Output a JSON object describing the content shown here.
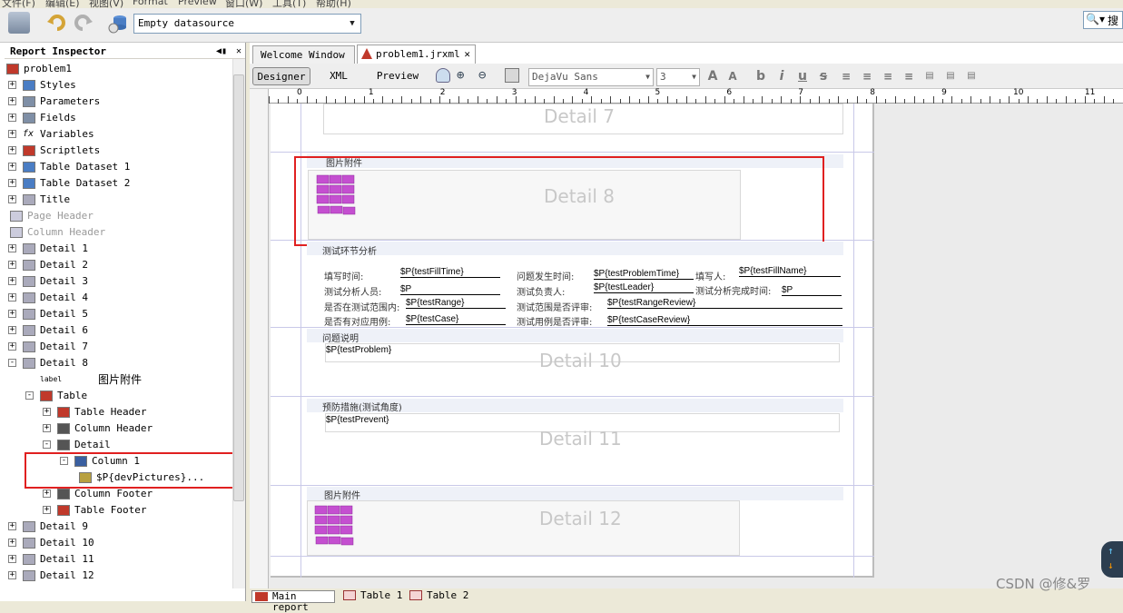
{
  "menubar": {
    "items": [
      "文件(F)",
      "编辑(E)",
      "视图(V)",
      "Format",
      "Preview",
      "窗口(W)",
      "工具(T)",
      "帮助(H)"
    ]
  },
  "toolbar": {
    "datasource": "Empty datasource",
    "search_label": "搜"
  },
  "inspector": {
    "title": "Report Inspector",
    "items": [
      {
        "label": "problem1",
        "indent": 0
      },
      {
        "label": "Styles"
      },
      {
        "label": "Parameters"
      },
      {
        "label": "Fields"
      },
      {
        "label": "Variables"
      },
      {
        "label": "Scriptlets"
      },
      {
        "label": "Table Dataset 1"
      },
      {
        "label": "Table Dataset 2"
      },
      {
        "label": "Title"
      },
      {
        "label": "Page Header"
      },
      {
        "label": "Column Header"
      },
      {
        "label": "Detail 1"
      },
      {
        "label": "Detail 2"
      },
      {
        "label": "Detail 3"
      },
      {
        "label": "Detail 4"
      },
      {
        "label": "Detail 5"
      },
      {
        "label": "Detail 6"
      },
      {
        "label": "Detail 7"
      },
      {
        "label": "Detail 8"
      },
      {
        "label": "label"
      },
      {
        "label": "Table"
      },
      {
        "label": "Table Header"
      },
      {
        "label": "Column Header"
      },
      {
        "label": "Detail"
      },
      {
        "label": "Column 1"
      },
      {
        "label": "$P{devPictures}..."
      },
      {
        "label": "Column Footer"
      },
      {
        "label": "Table Footer"
      },
      {
        "label": "Detail 9"
      },
      {
        "label": "Detail 10"
      },
      {
        "label": "Detail 11"
      },
      {
        "label": "Detail 12"
      }
    ],
    "annotation": "图片附件"
  },
  "editor": {
    "tabs": [
      "Welcome Window",
      "problem1.jrxml"
    ],
    "view_buttons": [
      "Designer",
      "XML",
      "Preview"
    ],
    "font_name": "DejaVu Sans",
    "font_size": "3",
    "ruler_labels": [
      "0",
      "1",
      "2",
      "3",
      "4",
      "5",
      "6",
      "7",
      "8",
      "9",
      "10",
      "11"
    ]
  },
  "design": {
    "bands": {
      "detail7": "Detail 7",
      "detail8": "Detail 8",
      "detail10": "Detail 10",
      "detail11": "Detail 11",
      "detail12": "Detail 12"
    },
    "attach_label_1": "图片附件",
    "attach_label_2": "图片附件",
    "analysis_title": "测试环节分析",
    "fill_time_label": "填写时间:",
    "fill_time_field": "$P{testFillTime}",
    "problem_time_label": "问题发生时间:",
    "problem_time_field": "$P{testProblemTime}",
    "filler_label": "填写人:",
    "filler_field": "$P{testFillName}",
    "analyst_label": "测试分析人员:",
    "analyst_field": "$P",
    "leader_label": "测试负责人:",
    "leader_field": "$P{testLeader}",
    "finish_time_label": "测试分析完成时间:",
    "finish_time_field": "$P",
    "in_range_label": "是否在测试范围内:",
    "in_range_field": "$P{testRange}",
    "range_review_label": "测试范围是否评审:",
    "range_review_field": "$P{testRangeReview}",
    "has_case_label": "是否有对应用例:",
    "has_case_field": "$P{testCase}",
    "case_review_label": "测试用例是否评审:",
    "case_review_field": "$P{testCaseReview}",
    "problem_desc_label": "问题说明",
    "problem_field": "$P{testProblem}",
    "prevent_label": "预防措施(测试角度)",
    "prevent_field": "$P{testPrevent}"
  },
  "bottom_tabs": [
    "Main report",
    "Table 1",
    "Table 2"
  ],
  "watermark": "CSDN @修&罗"
}
